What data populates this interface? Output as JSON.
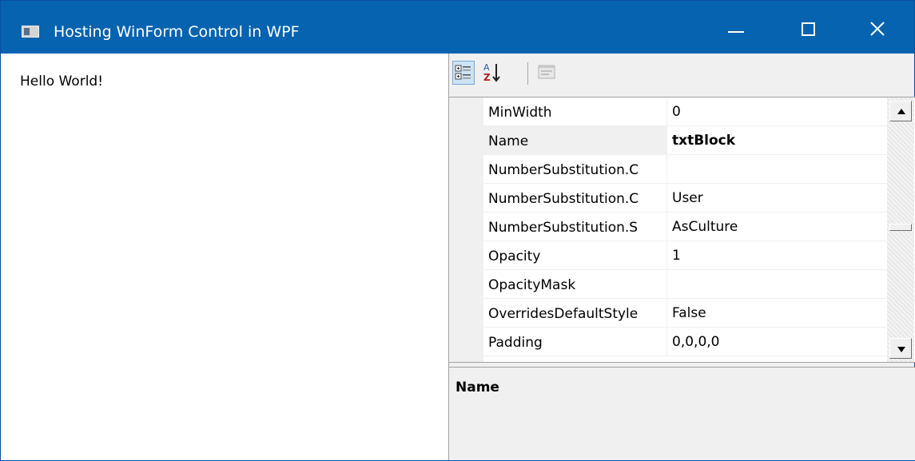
{
  "window": {
    "title": "Hosting WinForm Control in WPF",
    "accent_color": "#0563b0"
  },
  "caption_buttons": {
    "minimize_icon": "minimize-icon",
    "maximize_icon": "maximize-icon",
    "close_icon": "close-icon"
  },
  "content": {
    "text_block": "Hello World!"
  },
  "property_grid": {
    "toolbar": {
      "categorized_icon": "categorized-icon",
      "alphabetical_icon": "sort-alphabetical-icon",
      "property_pages_icon": "property-pages-icon"
    },
    "rows": [
      {
        "name": "MinWidth",
        "value": "0",
        "selected": false
      },
      {
        "name": "Name",
        "value": "txtBlock",
        "selected": true
      },
      {
        "name": "NumberSubstitution.C",
        "value": "",
        "selected": false
      },
      {
        "name": "NumberSubstitution.C",
        "value": "User",
        "selected": false
      },
      {
        "name": "NumberSubstitution.S",
        "value": "AsCulture",
        "selected": false
      },
      {
        "name": "Opacity",
        "value": "1",
        "selected": false
      },
      {
        "name": "OpacityMask",
        "value": "",
        "selected": false
      },
      {
        "name": "OverridesDefaultStyle",
        "value": "False",
        "selected": false
      },
      {
        "name": "Padding",
        "value": "0,0,0,0",
        "selected": false
      }
    ],
    "help": {
      "title": "Name"
    }
  }
}
